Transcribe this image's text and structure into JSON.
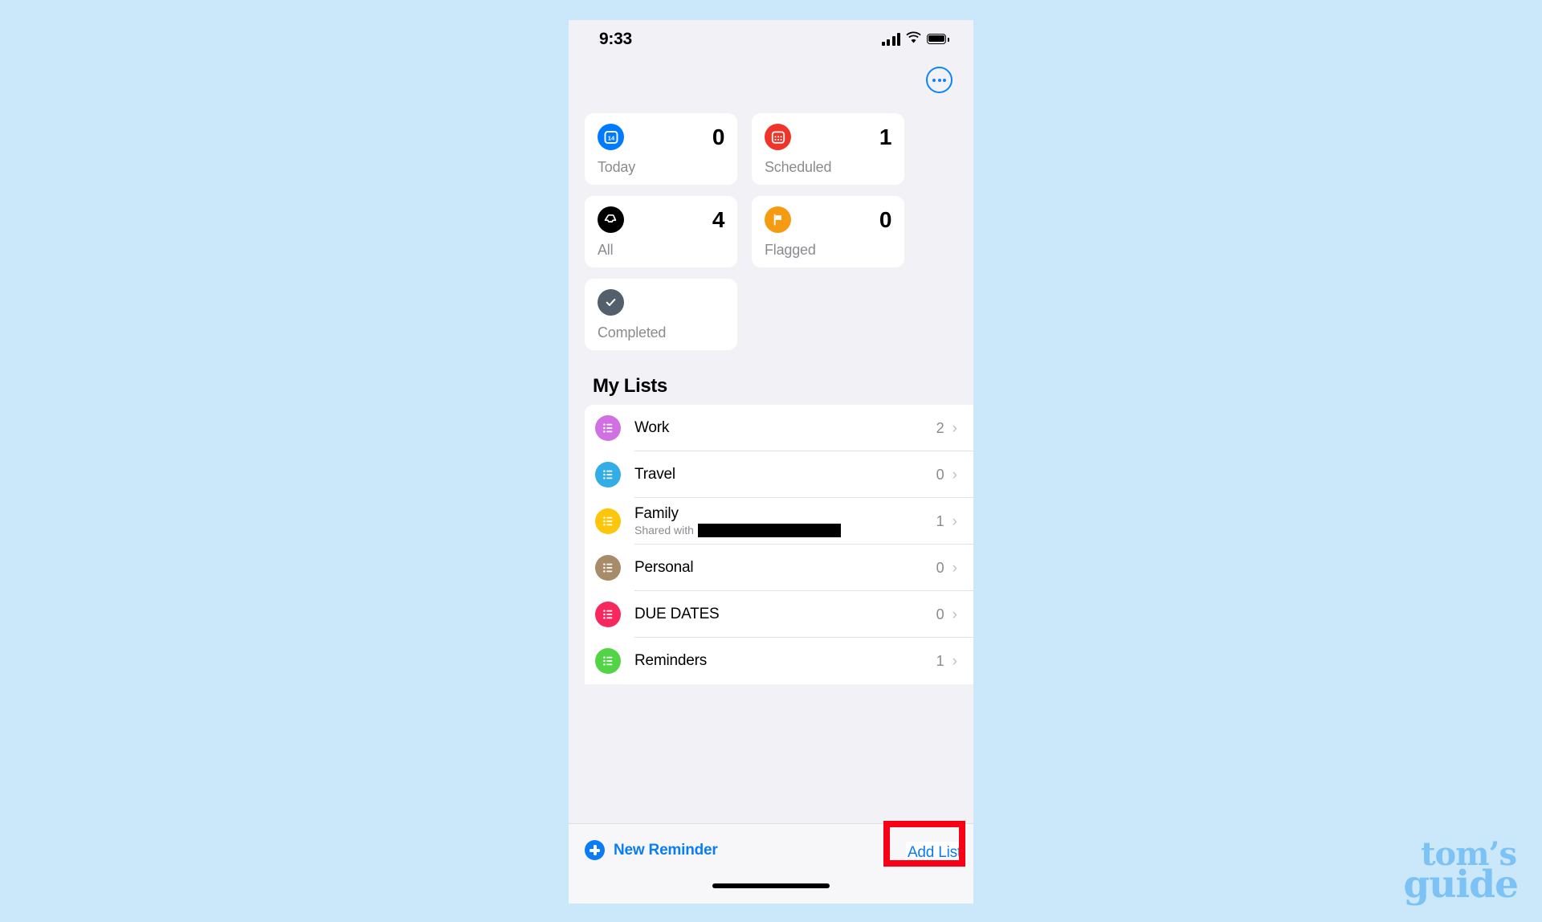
{
  "page": {
    "background_color": "#cbe8fb"
  },
  "status_bar": {
    "time": "9:33",
    "icons": [
      "cellular-signal-icon",
      "wifi-icon",
      "battery-icon"
    ]
  },
  "header": {
    "more_button_icon": "ellipsis-circle-icon"
  },
  "smart_lists": [
    {
      "name": "Today",
      "count": "0",
      "icon": "calendar-day-icon",
      "color": "#007aff"
    },
    {
      "name": "Scheduled",
      "count": "1",
      "icon": "calendar-grid-icon",
      "color": "#f03428"
    },
    {
      "name": "All",
      "count": "4",
      "icon": "inbox-tray-icon",
      "color": "#000000"
    },
    {
      "name": "Flagged",
      "count": "0",
      "icon": "flag-icon",
      "color": "#f59b12"
    },
    {
      "name": "Completed",
      "count": "",
      "icon": "checkmark-icon",
      "color": "#53606b"
    }
  ],
  "my_lists": {
    "title": "My Lists",
    "items": [
      {
        "name": "Work",
        "count": "2",
        "color": "#cf71e0",
        "icon": "bullet-list-icon",
        "subtitle": "",
        "redacted": false
      },
      {
        "name": "Travel",
        "count": "0",
        "color": "#32ade6",
        "icon": "bullet-list-icon",
        "subtitle": "",
        "redacted": false
      },
      {
        "name": "Family",
        "count": "1",
        "color": "#fdc60b",
        "icon": "bullet-list-icon",
        "subtitle": "Shared with",
        "redacted": true
      },
      {
        "name": "Personal",
        "count": "0",
        "color": "#a88b68",
        "icon": "bullet-list-icon",
        "subtitle": "",
        "redacted": false
      },
      {
        "name": "DUE DATES",
        "count": "0",
        "color": "#f8285f",
        "icon": "bullet-list-icon",
        "subtitle": "",
        "redacted": false
      },
      {
        "name": "Reminders",
        "count": "1",
        "color": "#53d447",
        "icon": "bullet-list-icon",
        "subtitle": "",
        "redacted": false
      }
    ],
    "chevron_glyph": "›"
  },
  "toolbar": {
    "new_reminder_label": "New Reminder",
    "new_reminder_icon": "plus-circle-icon",
    "add_list_label": "Add List",
    "accent_color": "#0a7cf6",
    "highlight_color": "#f80015"
  },
  "watermark": {
    "line1": "tom’s",
    "line2": "guide",
    "color": "#7cc2f4"
  }
}
